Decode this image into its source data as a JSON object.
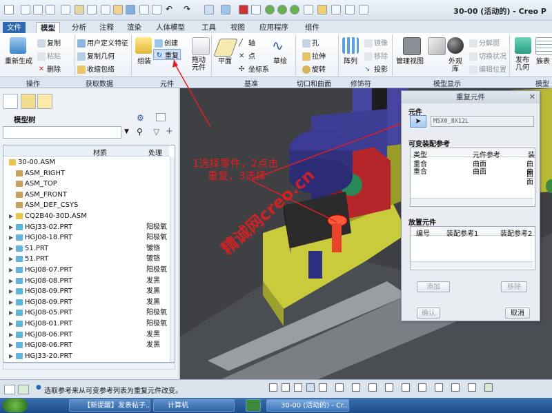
{
  "window": {
    "title": "30-00 (活动的) - Creo P"
  },
  "ribbon": {
    "tabs": [
      "文件",
      "模型",
      "分析",
      "注释",
      "渲染",
      "人体模型",
      "工具",
      "视图",
      "应用程序",
      "组件"
    ],
    "active_tab": "模型",
    "groups": {
      "operations": "操作",
      "get_data": "获取数据",
      "component": "元件",
      "datum": "基准",
      "cut_surface": "切口和曲面",
      "modifiers": "修饰符",
      "model_display": "模型显示",
      "model_intent": "模型"
    },
    "buttons": {
      "regenerate": "重新生成",
      "copy": "复制",
      "paste": "粘贴",
      "delete": "删除",
      "user_feature": "用户定义特征",
      "copy_geometry": "复制几何",
      "shrinkwrap": "收缩包络",
      "assemble": "组装",
      "create": "创建",
      "repeat": "重复",
      "drag": "拖动\n元件",
      "plane": "平面",
      "axis": "轴",
      "point": "点",
      "csys": "坐标系",
      "sketch": "草绘",
      "hole": "孔",
      "extrude": "拉伸",
      "revolve": "旋转",
      "pattern": "阵列",
      "mirror": "镜像",
      "remove": "移除",
      "project": "投影",
      "manage_views": "管理视图",
      "appearance": "外观\n库",
      "explode_view": "分解图",
      "toggle_status": "切换状况",
      "edit_position": "编辑位置",
      "publish": "发布\n几何",
      "sidebar_more": "族表"
    }
  },
  "model_tree": {
    "title": "模型树",
    "columns": {
      "name": "",
      "material": "材质",
      "process": "处理"
    },
    "rows": [
      {
        "name": "30-00.ASM",
        "process": "",
        "type": "asm",
        "level": 0,
        "expand": ""
      },
      {
        "name": "ASM_RIGHT",
        "process": "",
        "type": "datum",
        "level": 1,
        "expand": ""
      },
      {
        "name": "ASM_TOP",
        "process": "",
        "type": "datum",
        "level": 1,
        "expand": ""
      },
      {
        "name": "ASM_FRONT",
        "process": "",
        "type": "datum",
        "level": 1,
        "expand": ""
      },
      {
        "name": "ASM_DEF_CSYS",
        "process": "",
        "type": "csys",
        "level": 1,
        "expand": ""
      },
      {
        "name": "CQ2B40-30D.ASM",
        "process": "",
        "type": "asm",
        "level": 1,
        "expand": "▶"
      },
      {
        "name": "HGJ33-02.PRT",
        "process": "阳极氧",
        "type": "prt",
        "level": 1,
        "expand": "▶"
      },
      {
        "name": "HGJ08-18.PRT",
        "process": "阳极氧",
        "type": "prt",
        "level": 1,
        "expand": "▶"
      },
      {
        "name": "51.PRT",
        "process": "镀铬",
        "type": "prt",
        "level": 1,
        "expand": "▶"
      },
      {
        "name": "51.PRT",
        "process": "镀铬",
        "type": "prt",
        "level": 1,
        "expand": "▶"
      },
      {
        "name": "HGJ08-07.PRT",
        "process": "阳极氧",
        "type": "prt",
        "level": 1,
        "expand": "▶"
      },
      {
        "name": "HGJ08-08.PRT",
        "process": "发黑",
        "type": "prt",
        "level": 1,
        "expand": "▶"
      },
      {
        "name": "HGJ08-09.PRT",
        "process": "发黑",
        "type": "prt",
        "level": 1,
        "expand": "▶"
      },
      {
        "name": "HGJ08-09.PRT",
        "process": "发黑",
        "type": "prt",
        "level": 1,
        "expand": "▶"
      },
      {
        "name": "HGJ08-05.PRT",
        "process": "阳极氧",
        "type": "prt",
        "level": 1,
        "expand": "▶"
      },
      {
        "name": "HGJ08-01.PRT",
        "process": "阳极氧",
        "type": "prt",
        "level": 1,
        "expand": "▶"
      },
      {
        "name": "HGJ08-06.PRT",
        "process": "发黑",
        "type": "prt",
        "level": 1,
        "expand": "▶"
      },
      {
        "name": "HGJ08-06.PRT",
        "process": "发黑",
        "type": "prt",
        "level": 1,
        "expand": "▶"
      },
      {
        "name": "HGJ33-20.PRT",
        "process": "",
        "type": "prt",
        "level": 1,
        "expand": "▶"
      }
    ]
  },
  "dialog": {
    "title": "重复元件",
    "component_label": "元件",
    "component_value": "M5X0_8X12L",
    "variable_refs_label": "可变装配参考",
    "var_cols": [
      "类型",
      "元件参考",
      "装"
    ],
    "var_rows": [
      [
        "重合",
        "曲面",
        "曲面"
      ],
      [
        "重合",
        "曲面",
        "曲面"
      ]
    ],
    "place_label": "放置元件",
    "place_cols": [
      "编号",
      "装配参考1",
      "装配参考2"
    ],
    "add_button": "添加",
    "remove_button": "移除",
    "confirm_button": "确认",
    "cancel_button": "取消"
  },
  "annotation": {
    "line1": "1选择零件，2点击",
    "line2": "重复，3选择"
  },
  "watermark": "精诚网creo.cn",
  "status": {
    "message": "选取参考来从可变参考列表为重复元件改变。"
  },
  "taskbar": {
    "items": [
      "【新提醒】发表帖子...",
      "计算机",
      "",
      "30-00 (活动的) - Cr..."
    ]
  }
}
